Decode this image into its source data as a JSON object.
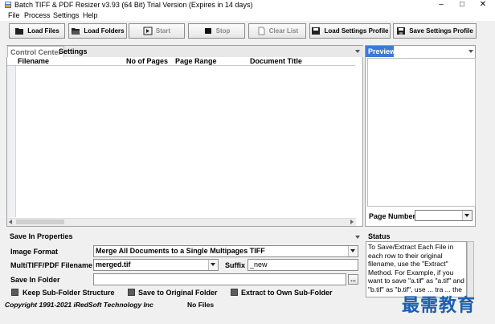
{
  "window": {
    "title": "Batch TIFF & PDF Resizer v3.93 (64 Bit)  Trial Version (Expires in 14 days)",
    "controls": {
      "minimize": "–",
      "maximize": "□",
      "close": "✕"
    }
  },
  "menu": [
    "File",
    "Process",
    "Settings",
    "Help"
  ],
  "toolbar": {
    "load_files": "Load Files",
    "load_folders": "Load Folders",
    "start": "Start",
    "stop": "Stop",
    "clear_list": "Clear List",
    "load_settings_profile": "Load Settings Profile",
    "save_settings_profile": "Save Settings Profile"
  },
  "tabs": {
    "control_center": "Control Center",
    "settings": "Settings"
  },
  "grid": {
    "columns": [
      "Filename",
      "No of Pages",
      "Page Range",
      "Document Title"
    ]
  },
  "preview": {
    "tab": "Preview",
    "page_number_label": "Page Number",
    "page_number_value": ""
  },
  "save": {
    "header": "Save In Properties",
    "image_format_label": "Image Format",
    "image_format_value": "Merge All Documents to a Single Multipages TIFF",
    "multi_filename_label": "MultiTIFF/PDF Filename",
    "multi_filename_value": "merged.tif",
    "suffix_label": "Suffix",
    "suffix_value": "_new",
    "folder_label": "Save In Folder",
    "folder_value": "",
    "browse": "...",
    "keep_subfolder": "Keep Sub-Folder Structure",
    "save_original": "Save to Original Folder",
    "extract_own": "Extract to Own Sub-Folder"
  },
  "status": {
    "label": "Status",
    "text": "To Save/Extract Each File in each row to their original filename, use the \"Extract\" Method. For Example, if you want to save \"a.tif\" as \"a.tif\" and \"b.tif\" as \"b.tif\", use ... tra ... the"
  },
  "statusbar": {
    "copyright": "Copyright 1991-2021 iRedSoft Technology Inc",
    "files": "No Files"
  },
  "watermark": "最需教育",
  "colors": {
    "accent": "#3a7bd5",
    "watermark": "#1b5fae"
  }
}
